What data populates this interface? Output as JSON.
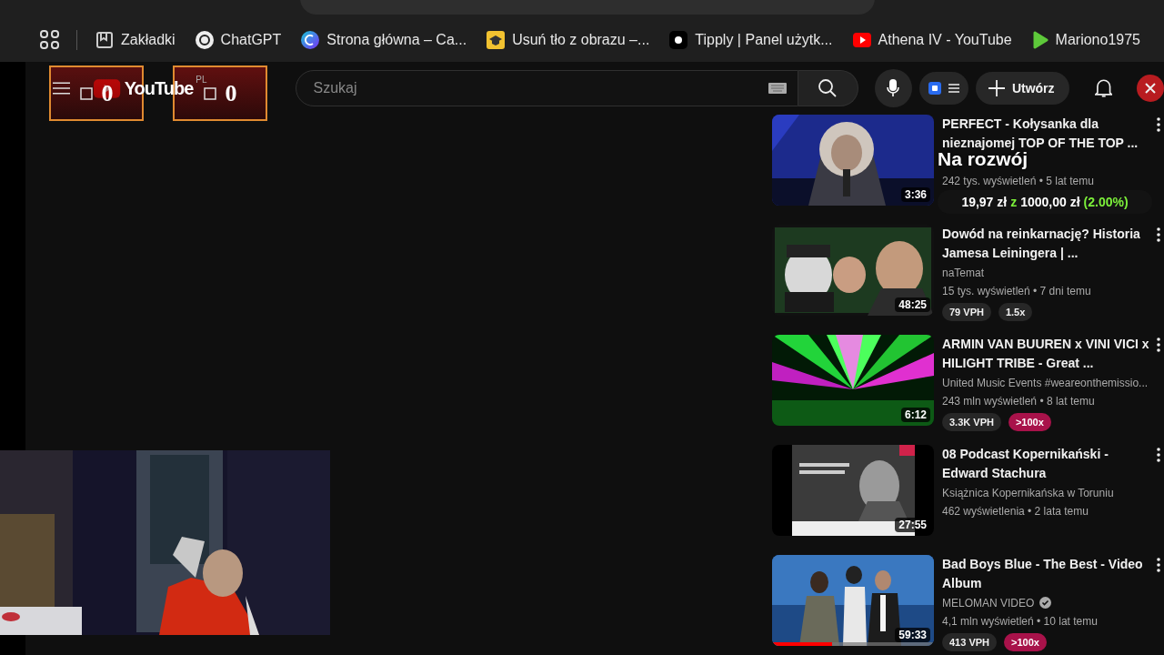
{
  "bookmarks": [
    {
      "label": "Zakładki",
      "kind": "folder"
    },
    {
      "label": "ChatGPT",
      "kind": "chatgpt"
    },
    {
      "label": "Strona główna – Ca...",
      "kind": "canva"
    },
    {
      "label": "Usuń tło z obrazu –...",
      "kind": "cap"
    },
    {
      "label": "Tipply | Panel użytk...",
      "kind": "tip"
    },
    {
      "label": "Athena IV - YouTube",
      "kind": "youtube"
    },
    {
      "label": "Mariono1975",
      "kind": "play"
    }
  ],
  "header": {
    "logo": "YouTube",
    "region": "PL",
    "search": {
      "placeholder": "Szukaj"
    },
    "create_button": "Utwórz",
    "counters": [
      {
        "value": "0"
      },
      {
        "value": "0"
      }
    ]
  },
  "goal_overlay": {
    "title": "Na rozwój",
    "amount": [
      {
        "text": "19,97 zł",
        "kind": "plain"
      },
      {
        "text": "z",
        "kind": "accent"
      },
      {
        "text": "1000,00 zł",
        "kind": "plain"
      },
      {
        "text": "(2.00%)",
        "kind": "accent"
      }
    ]
  },
  "videos": [
    {
      "title": "PERFECT - Kołysanka dla nieznajomej TOP OF THE TOP ...",
      "duration": "3:36",
      "meta": "242 tys. wyświetleń • 5 lat temu"
    },
    {
      "title": "Dowód na reinkarnację? Historia Jamesa Leiningera | ...",
      "duration": "48:25",
      "channel": "naTemat",
      "verified": false,
      "meta": "15 tys. wyświetleń • 7 dni temu",
      "badges": [
        {
          "text": "79 VPH",
          "kind": "plain"
        },
        {
          "text": "1.5x",
          "kind": "plain"
        }
      ]
    },
    {
      "title": "ARMIN VAN BUUREN x VINI VICI x HILIGHT TRIBE - Great ...",
      "duration": "6:12",
      "channel": "United Music Events #weareonthemissio...",
      "verified": false,
      "meta": "243 mln wyświetleń • 8 lat temu",
      "badges": [
        {
          "text": "3.3K VPH",
          "kind": "plain"
        },
        {
          "text": ">100x",
          "kind": "hot"
        }
      ]
    },
    {
      "title": "08 Podcast Kopernikański - Edward Stachura",
      "duration": "27:55",
      "channel": "Książnica Kopernikańska w Toruniu",
      "verified": false,
      "meta": "462 wyświetlenia • 2 lata temu"
    },
    {
      "title": "Bad Boys Blue - The Best - Video Album",
      "duration": "59:33",
      "channel": "MELOMAN VIDEO",
      "verified": true,
      "meta": "4,1 mln wyświetleń • 10 lat temu",
      "level": 0.37,
      "badges": [
        {
          "text": "413 VPH",
          "kind": "plain"
        },
        {
          "text": ">100x",
          "kind": "hot"
        }
      ]
    }
  ]
}
